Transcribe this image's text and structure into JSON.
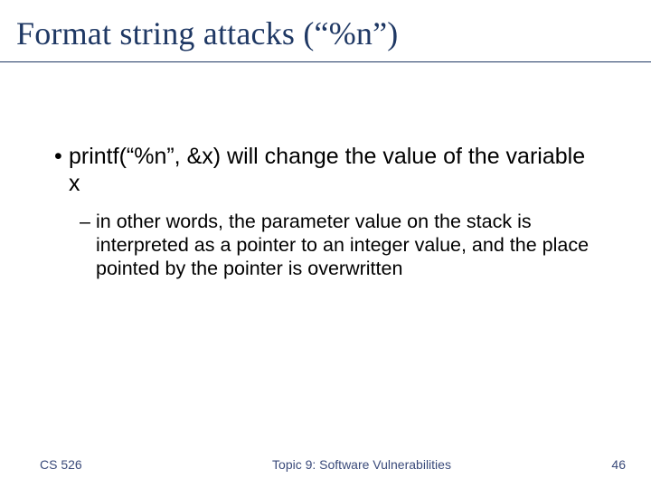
{
  "title": "Format string attacks (“%n”)",
  "bullets": {
    "l1": "printf(“%n”, &x) will change the value of the variable x",
    "l2": "in other words, the parameter value on the stack is interpreted as a pointer to an integer value, and the place pointed by the pointer is overwritten"
  },
  "footer": {
    "course": "CS 526",
    "topic": "Topic 9: Software Vulnerabilities",
    "page": "46"
  }
}
